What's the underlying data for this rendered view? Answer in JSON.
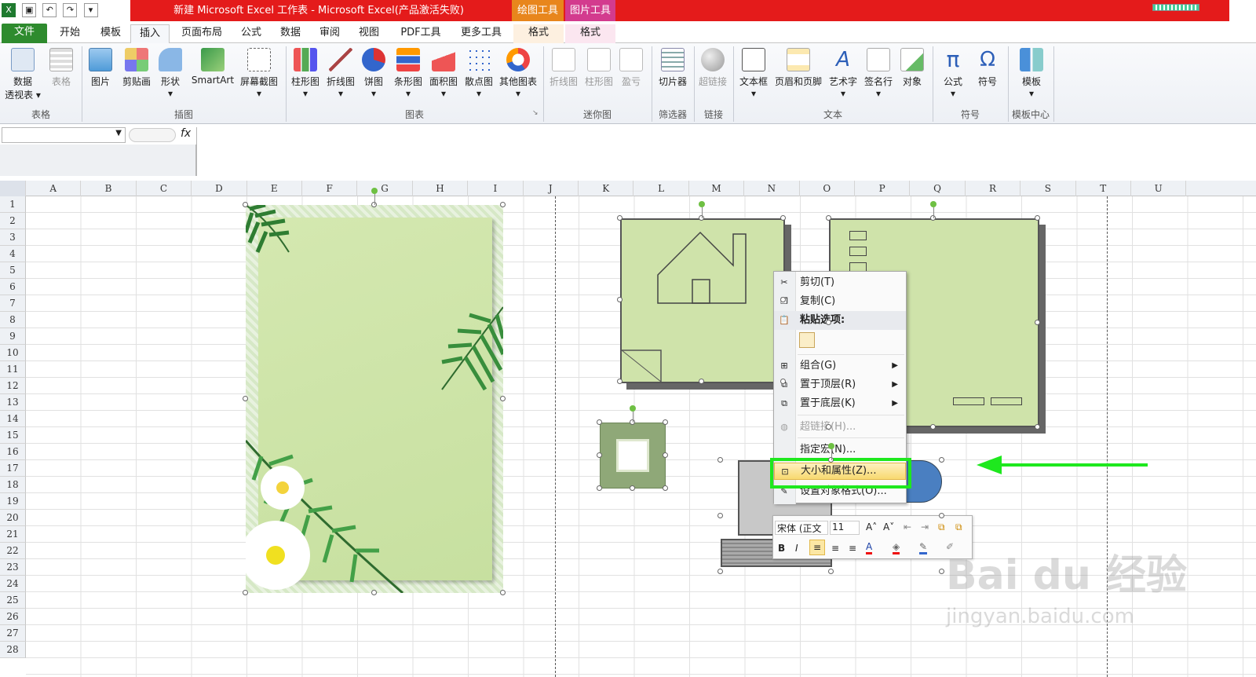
{
  "window": {
    "title": "新建 Microsoft Excel 工作表 - Microsoft Excel(产品激活失败)",
    "context_tabs": [
      "绘图工具",
      "图片工具"
    ],
    "context_sub_tabs": [
      "格式",
      "格式"
    ]
  },
  "tabs": [
    "文件",
    "开始",
    "模板",
    "插入",
    "页面布局",
    "公式",
    "数据",
    "审阅",
    "视图",
    "PDF工具",
    "更多工具"
  ],
  "active_tab": "插入",
  "ribbon": {
    "buttons": [
      {
        "line1": "数据",
        "line2": "透视表 ▾"
      },
      {
        "line1": "表格",
        "line2": ""
      },
      {
        "line1": "图片",
        "line2": ""
      },
      {
        "line1": "剪贴画",
        "line2": ""
      },
      {
        "line1": "形状",
        "line2": "▾"
      },
      {
        "line1": "SmartArt",
        "line2": ""
      },
      {
        "line1": "屏幕截图",
        "line2": "▾"
      },
      {
        "line1": "柱形图",
        "line2": "▾"
      },
      {
        "line1": "折线图",
        "line2": "▾"
      },
      {
        "line1": "饼图",
        "line2": "▾"
      },
      {
        "line1": "条形图",
        "line2": "▾"
      },
      {
        "line1": "面积图",
        "line2": "▾"
      },
      {
        "line1": "散点图",
        "line2": "▾"
      },
      {
        "line1": "其他图表",
        "line2": "▾"
      },
      {
        "line1": "折线图",
        "line2": ""
      },
      {
        "line1": "柱形图",
        "line2": ""
      },
      {
        "line1": "盈亏",
        "line2": ""
      },
      {
        "line1": "切片器",
        "line2": ""
      },
      {
        "line1": "超链接",
        "line2": ""
      },
      {
        "line1": "文本框",
        "line2": "▾"
      },
      {
        "line1": "页眉和页脚",
        "line2": ""
      },
      {
        "line1": "艺术字",
        "line2": "▾"
      },
      {
        "line1": "签名行",
        "line2": "▾"
      },
      {
        "line1": "对象",
        "line2": ""
      },
      {
        "line1": "公式",
        "line2": "▾"
      },
      {
        "line1": "符号",
        "line2": ""
      },
      {
        "line1": "模板",
        "line2": "▾"
      }
    ],
    "groups": [
      "表格",
      "插图",
      "图表",
      "迷你图",
      "筛选器",
      "链接",
      "文本",
      "符号",
      "模板中心"
    ]
  },
  "formula": {
    "fx_label": "fx",
    "name_value": "",
    "formula_value": ""
  },
  "columns": [
    "A",
    "B",
    "C",
    "D",
    "E",
    "F",
    "G",
    "H",
    "I",
    "J",
    "K",
    "L",
    "M",
    "N",
    "O",
    "P",
    "Q",
    "R",
    "S",
    "T",
    "U"
  ],
  "rows": [
    "1",
    "2",
    "3",
    "4",
    "5",
    "6",
    "7",
    "8",
    "9",
    "10",
    "11",
    "12",
    "13",
    "14",
    "15",
    "16",
    "17",
    "18",
    "19",
    "20",
    "21",
    "22",
    "23",
    "24",
    "25",
    "26",
    "27",
    "28"
  ],
  "context_menu": {
    "cut": "剪切(T)",
    "copy": "复制(C)",
    "paste_options": "粘贴选项:",
    "group": "组合(G)",
    "bring_front": "置于顶层(R)",
    "send_back": "置于底层(K)",
    "hyperlink": "超链接(H)...",
    "assign_macro": "指定宏(N)...",
    "size_props": "大小和属性(Z)...",
    "format_object": "设置对象格式(O)..."
  },
  "mini_toolbar": {
    "font": "宋体 (正文",
    "size": "11"
  },
  "watermark": {
    "line1": "Bai du 经验",
    "line2": "jingyan.baidu.com"
  },
  "colors": {
    "accent_green": "#1ee81e",
    "title_red": "#e41b1b",
    "shape_fill": "#cfe3aa"
  }
}
